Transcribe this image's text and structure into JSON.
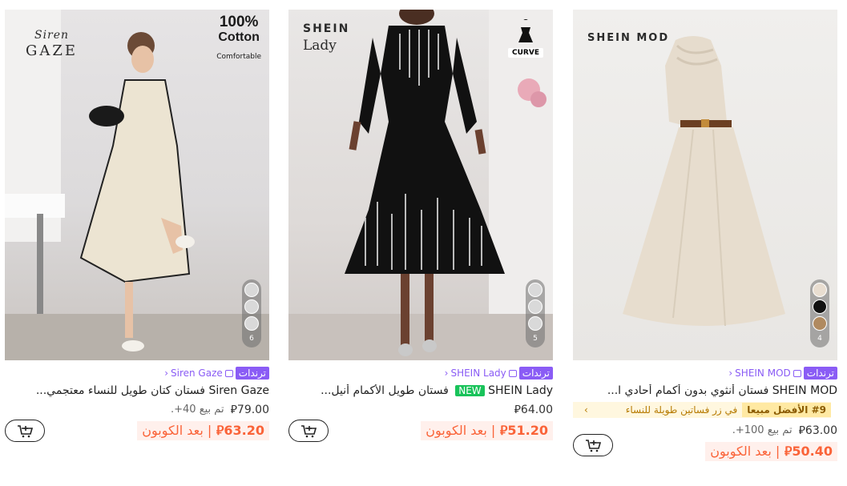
{
  "currency_symbol": "⃁",
  "coupon_suffix": "| بعد الكوبون",
  "products": [
    {
      "brand_lines": [
        "Siren",
        "GAZE"
      ],
      "badge": {
        "line1": "100%",
        "line2": "Cotton",
        "line3": "Comfortable"
      },
      "swatch_colors": [
        "#d9d9d9",
        "#d9d9d9",
        "#d9d9d9"
      ],
      "swatch_count": "6",
      "trend_label": "ترندات",
      "store_name": "Siren Gaze",
      "title": "Siren Gaze فستان كتان طويل للنساء معتجمي...",
      "original_price": "79.00",
      "sold_text": "تم بيع 40+.",
      "coupon_price": "63.20"
    },
    {
      "brand_lines": [
        "SHEIN",
        "Lady"
      ],
      "badge": {
        "curve_label": "CURVE"
      },
      "swatch_colors": [
        "#d9d9d9",
        "#d9d9d9",
        "#d9d9d9"
      ],
      "swatch_count": "5",
      "trend_label": "ترندات",
      "store_name": "SHEIN Lady",
      "new_label": "NEW",
      "title": "SHEIN Lady فستان طويل الأكمام أنيل...",
      "original_price": "64.00",
      "coupon_price": "51.20"
    },
    {
      "brand_lines": [
        "SHEIN MOD"
      ],
      "swatch_colors": [
        "#e8ddd0",
        "#111111",
        "#b08a60"
      ],
      "swatch_count": "4",
      "trend_label": "ترندات",
      "store_name": "SHEIN MOD",
      "title": "SHEIN MOD فستان أنثوي بدون أكمام أحادي ا...",
      "best_rank": "#9 الأفضل مبيعا",
      "best_category": "في زر فساتين طويلة للنساء",
      "original_price": "63.00",
      "sold_text": "تم بيع 100+.",
      "coupon_price": "50.40"
    }
  ]
}
